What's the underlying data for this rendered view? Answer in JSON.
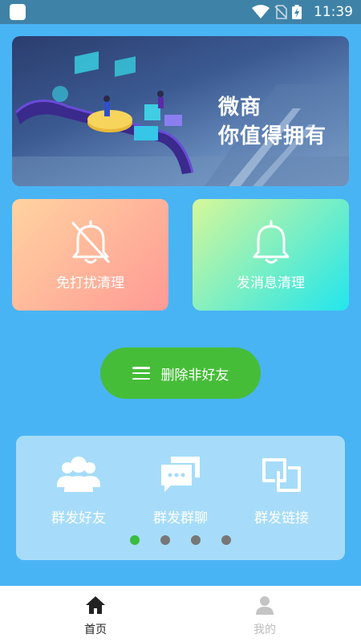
{
  "status_bar": {
    "time": "11:39",
    "icons": [
      "app-square-icon",
      "wifi-icon",
      "no-sim-icon",
      "battery-charging-icon"
    ]
  },
  "banner": {
    "line1": "微商",
    "line2": "你值得拥有"
  },
  "cards": [
    {
      "label": "免打扰清理",
      "icon": "bell-off-icon"
    },
    {
      "label": "发消息清理",
      "icon": "bell-icon"
    }
  ],
  "delete_button": {
    "label": "删除非好友",
    "icon": "menu-icon"
  },
  "features": [
    {
      "label": "群发好友",
      "icon": "group-users-icon"
    },
    {
      "label": "群发群聊",
      "icon": "chat-bubbles-icon"
    },
    {
      "label": "群发链接",
      "icon": "link-squares-icon"
    }
  ],
  "pager": {
    "pages": 4,
    "active": 1
  },
  "tabs": [
    {
      "label": "首页",
      "icon": "home-icon",
      "active": true
    },
    {
      "label": "我的",
      "icon": "person-icon",
      "active": false
    }
  ],
  "colors": {
    "background": "#49b4f4",
    "button_green": "#46bd38",
    "active_dot": "#3bbb3f"
  }
}
